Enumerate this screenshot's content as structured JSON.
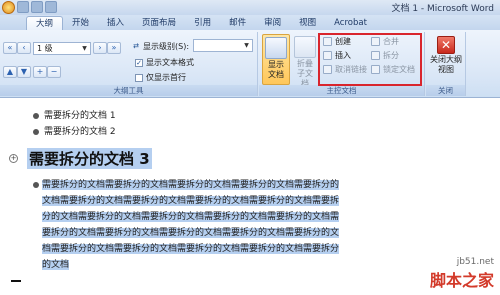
{
  "window": {
    "title": "文档 1 - Microsoft Word"
  },
  "tabs": [
    {
      "label": "大纲"
    },
    {
      "label": "开始"
    },
    {
      "label": "插入"
    },
    {
      "label": "页面布局"
    },
    {
      "label": "引用"
    },
    {
      "label": "邮件"
    },
    {
      "label": "审阅"
    },
    {
      "label": "视图"
    },
    {
      "label": "Acrobat"
    }
  ],
  "ribbon": {
    "outline_tools": {
      "level_value": "1 级",
      "show_level_label": "显示级别(S):",
      "show_text_format": "显示文本格式",
      "show_first_line": "仅显示首行",
      "group_label": "大纲工具"
    },
    "master_doc": {
      "show_document": "显示文档",
      "collapse_subdocs": "折叠子文档",
      "create": "创建",
      "insert": "插入",
      "unlink": "取消链接",
      "merge": "合并",
      "split": "拆分",
      "lock_document": "锁定文档",
      "group_label": "主控文档"
    },
    "close": {
      "close_outline": "关闭大纲视图",
      "group_label": "关闭"
    }
  },
  "document": {
    "items": [
      {
        "text": "需要拆分的文档 1"
      },
      {
        "text": "需要拆分的文档 2"
      }
    ],
    "heading": "需要拆分的文档 3",
    "body_lines": [
      "需要拆分的文档需要拆分的文档需要拆分的文档需要拆分的文档需要拆分的",
      "文档需要拆分的文档需要拆分的文档需要拆分的文档需要拆分的文档需要拆",
      "分的文档需要拆分的文档需要拆分的文档需要拆分的文档需要拆分的文档需",
      "要拆分的文档需要拆分的文档需要拆分的文档需要拆分的文档需要拆分的文",
      "档需要拆分的文档需要拆分的文档需要拆分的文档需要拆分的文档需要拆分",
      "的文档"
    ]
  },
  "watermark": {
    "site": "jb51.net",
    "name": "脚本之家"
  }
}
